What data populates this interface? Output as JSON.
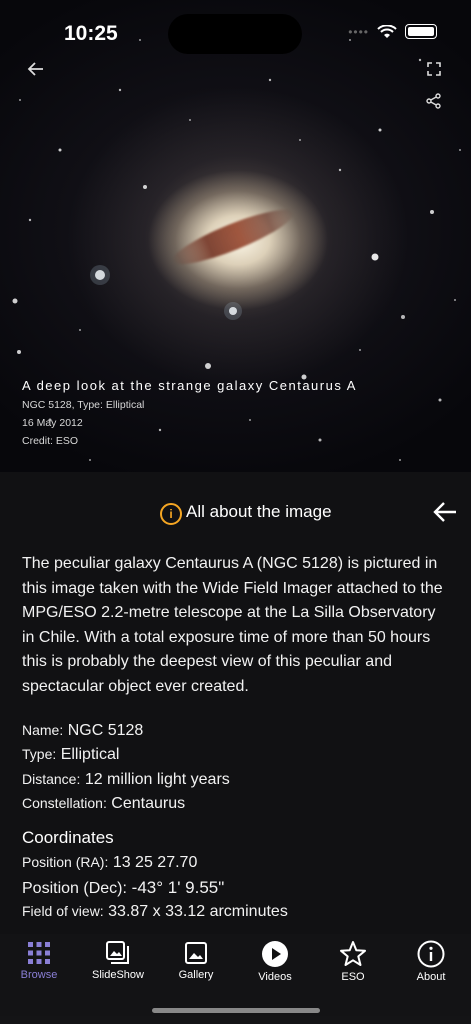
{
  "status": {
    "time": "10:25"
  },
  "image": {
    "title": "A deep look at the strange galaxy Centaurus A",
    "subtitle": "NGC 5128, Type: Elliptical",
    "date": "16 May 2012",
    "credit": "Credit: ESO"
  },
  "panel": {
    "title": "All about the image",
    "description": "The peculiar galaxy Centaurus A (NGC 5128) is pictured in this image taken with the Wide Field Imager attached to the MPG/ESO 2.2-metre telescope at the La Silla Observatory in Chile. With a total exposure time of more than 50 hours this is probably the deepest view of this peculiar and spectacular object ever created.",
    "name_label": "Name:",
    "name_value": "NGC 5128",
    "type_label": "Type:",
    "type_value": "Elliptical",
    "distance_label": "Distance:",
    "distance_value": "12 million light years",
    "constellation_label": "Constellation:",
    "constellation_value": "Centaurus",
    "coordinates_heading": "Coordinates",
    "ra_label": "Position (RA):",
    "ra_value": "13 25 27.70",
    "dec_label": "Position (Dec):",
    "dec_value": "-43° 1' 9.55\"",
    "fov_label": "Field of view:",
    "fov_value": "33.87 x 33.12 arcminutes"
  },
  "tabs": [
    {
      "label": "Browse",
      "icon": "grid-icon"
    },
    {
      "label": "SlideShow",
      "icon": "slideshow-icon"
    },
    {
      "label": "Gallery",
      "icon": "gallery-icon"
    },
    {
      "label": "Videos",
      "icon": "play-icon"
    },
    {
      "label": "ESO",
      "icon": "star-icon"
    },
    {
      "label": "About",
      "icon": "info-icon"
    }
  ],
  "colors": {
    "accent": "#f5a623",
    "active_tab": "#8a7fd6",
    "panel_bg": "#111113"
  }
}
